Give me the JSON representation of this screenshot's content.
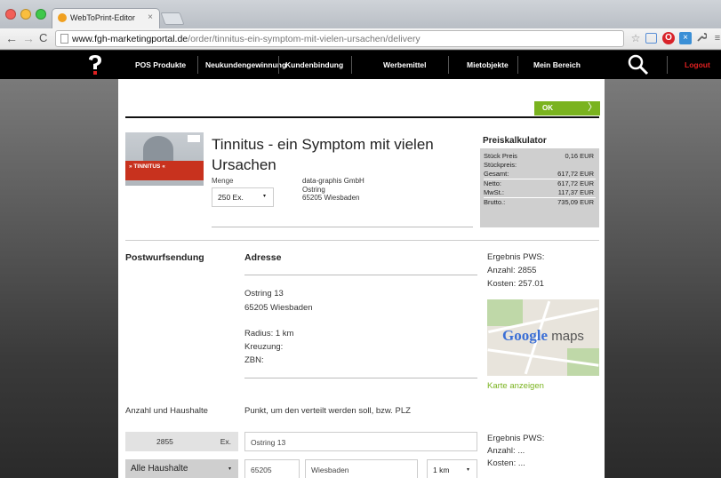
{
  "browser": {
    "tab_title": "WebToPrint-Editor",
    "tab_close": "×",
    "url_host": "www.fgh-marketingportal.de",
    "url_path": "/order/tinnitus-ein-symptom-mit-vielen-ursachen/delivery",
    "back_icon": "←",
    "forward_icon": "→",
    "reload_icon": "C",
    "star_icon": "☆",
    "wrench_icon": "🔧",
    "menu_icon": "≡",
    "opera_icon": "O",
    "ext_icon": "×"
  },
  "nav": {
    "items": [
      "POS Produkte",
      "Neukundengewinnung",
      "Kundenbindung",
      "Werbemittel",
      "Mietobjekte",
      "Mein Bereich"
    ],
    "logout": "Logout"
  },
  "toolbar": {
    "ok_label": "OK",
    "ok_arrow": "〉"
  },
  "product": {
    "image_text": "» TINNITUS «",
    "title": "Tinnitus - ein Symptom mit vielen Ursachen",
    "menge_label": "Menge",
    "menge_value": "250 Ex.",
    "caret": "▾",
    "company_name": "data-graphis GmbH",
    "street": "Ostring",
    "city": "65205 Wiesbaden"
  },
  "calculator": {
    "title": "Preiskalkulator",
    "rows": [
      {
        "label": "Stück Preis",
        "value": "0,16 EUR"
      },
      {
        "label": "Stückpreis:",
        "value": ""
      },
      {
        "label": "Gesamt:",
        "value": "617,72 EUR"
      },
      {
        "label": "Netto:",
        "value": "617,72 EUR"
      },
      {
        "label": "MwSt.:",
        "value": "117,37 EUR"
      },
      {
        "label": "Brutto.:",
        "value": "735,09 EUR"
      }
    ]
  },
  "section": {
    "post_heading": "Postwurfsendung",
    "adresse_heading": "Adresse",
    "address_line1": "Ostring 13",
    "address_line2": "65205 Wiesbaden",
    "radius": "Radius: 1 km",
    "kreuzung": "Kreuzung:",
    "zbn": "ZBN:",
    "pws_title": "Ergebnis PWS:",
    "pws_anzahl": "Anzahl: 2855",
    "pws_kosten": "Kosten: 257.01",
    "map_brand": "Google",
    "map_word": "maps",
    "map_link": "Karte anzeigen"
  },
  "form": {
    "anzahl_label": "Anzahl und Haushalte",
    "punkt_label": "Punkt, um den verteilt werden soll, bzw. PLZ",
    "count_value": "2855",
    "count_unit": "Ex.",
    "street_value": "Ostring 13",
    "households_value": "Alle Haushalte",
    "plz_value": "65205",
    "city_value": "Wiesbaden",
    "km_value": "1 km",
    "pws_title": "Ergebnis PWS:",
    "pws_anzahl": "Anzahl: ...",
    "pws_kosten": "Kosten: ..."
  }
}
